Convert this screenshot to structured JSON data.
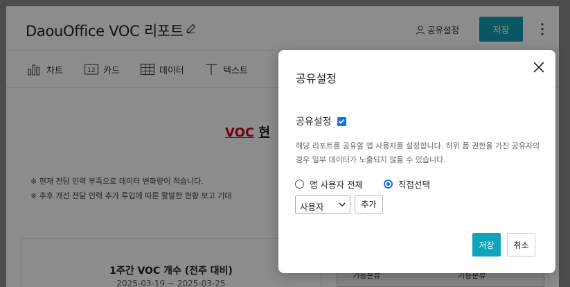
{
  "header": {
    "title": "DaouOffice VOC 리포트",
    "share_settings_label": "공유설정",
    "save_label": "저장"
  },
  "toolbar": {
    "items": [
      {
        "label": "차트",
        "icon": "bar-chart-icon"
      },
      {
        "label": "카드",
        "icon": "card-number-icon"
      },
      {
        "label": "데이터",
        "icon": "table-icon"
      },
      {
        "label": "텍스트",
        "icon": "text-icon"
      }
    ]
  },
  "content": {
    "heading_red": "VOC",
    "heading_dark": "현",
    "notes": [
      "※ 현재 전담 인력 부족으로 데이터 변화량이 적습니다.",
      "※ 추후 개선 전담 인력 추가 투입에 따른 활발한 현황 보고 기대"
    ],
    "card": {
      "title": "1주간 VOC 개수 (전주 대비)",
      "date_range": "2025-03-19 ~ 2025-03-25"
    },
    "right_table_headers": [
      "기능분류",
      "기능분류"
    ]
  },
  "modal": {
    "title": "공유설정",
    "share_label": "공유설정",
    "share_checked": true,
    "description": "해당 리포트를 공유할 앱 사용자를 설정합니다. 하위 폼 권한을 가진 공유자의 경우 일부 데이터가 노출되지 않을 수 있습니다.",
    "radio_all_label": "앱 사용자 전체",
    "radio_direct_label": "직접선택",
    "selected_radio": "직접선택",
    "select_value": "사용자",
    "add_label": "추가",
    "save_label": "저장",
    "cancel_label": "취소"
  },
  "colors": {
    "accent": "#0f9fb2",
    "checkbox": "#1a73e8",
    "voc_red": "#d0021b"
  }
}
